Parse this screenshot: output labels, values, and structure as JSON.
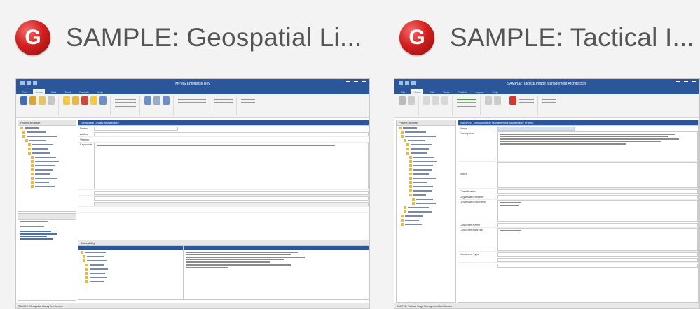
{
  "colors": {
    "brand_red": "#d3201f",
    "app_blue": "#2b579a"
  },
  "cards": [
    {
      "title": "SAMPLE: Geospatial Li...",
      "logo_letter": "G",
      "thumb": {
        "window_title": "MPMS Enterprise Rev",
        "tabs": [
          "File",
          "Home",
          "Edit",
          "Tools",
          "Publish",
          "Help"
        ],
        "browser_header": "Project Browser",
        "detail_header": "Geospatial Library Architecture",
        "fields": [
          "Name",
          "Author",
          "Version",
          "Keywords"
        ],
        "lower_header": "Traceability",
        "status": "SAMPLE: Geospatial Library Architecture"
      }
    },
    {
      "title": "SAMPLE: Tactical I...",
      "logo_letter": "G",
      "thumb": {
        "window_title": "SAMPLE: Tactical Image Management Architecture",
        "tabs": [
          "File",
          "Home",
          "Edit",
          "Tools",
          "Publish",
          "Layout",
          "Help"
        ],
        "browser_header": "Project Browser",
        "detail_header": "SAMPLE: Tactical Image Management Architecture Project",
        "fields": [
          "Name",
          "Description",
          "Notes",
          "Classification",
          "Organization Name",
          "Organization Address",
          "Customer Name",
          "Customer Address",
          "Document Type"
        ],
        "status": "SAMPLE: Tactical Image Management Architecture"
      }
    }
  ]
}
